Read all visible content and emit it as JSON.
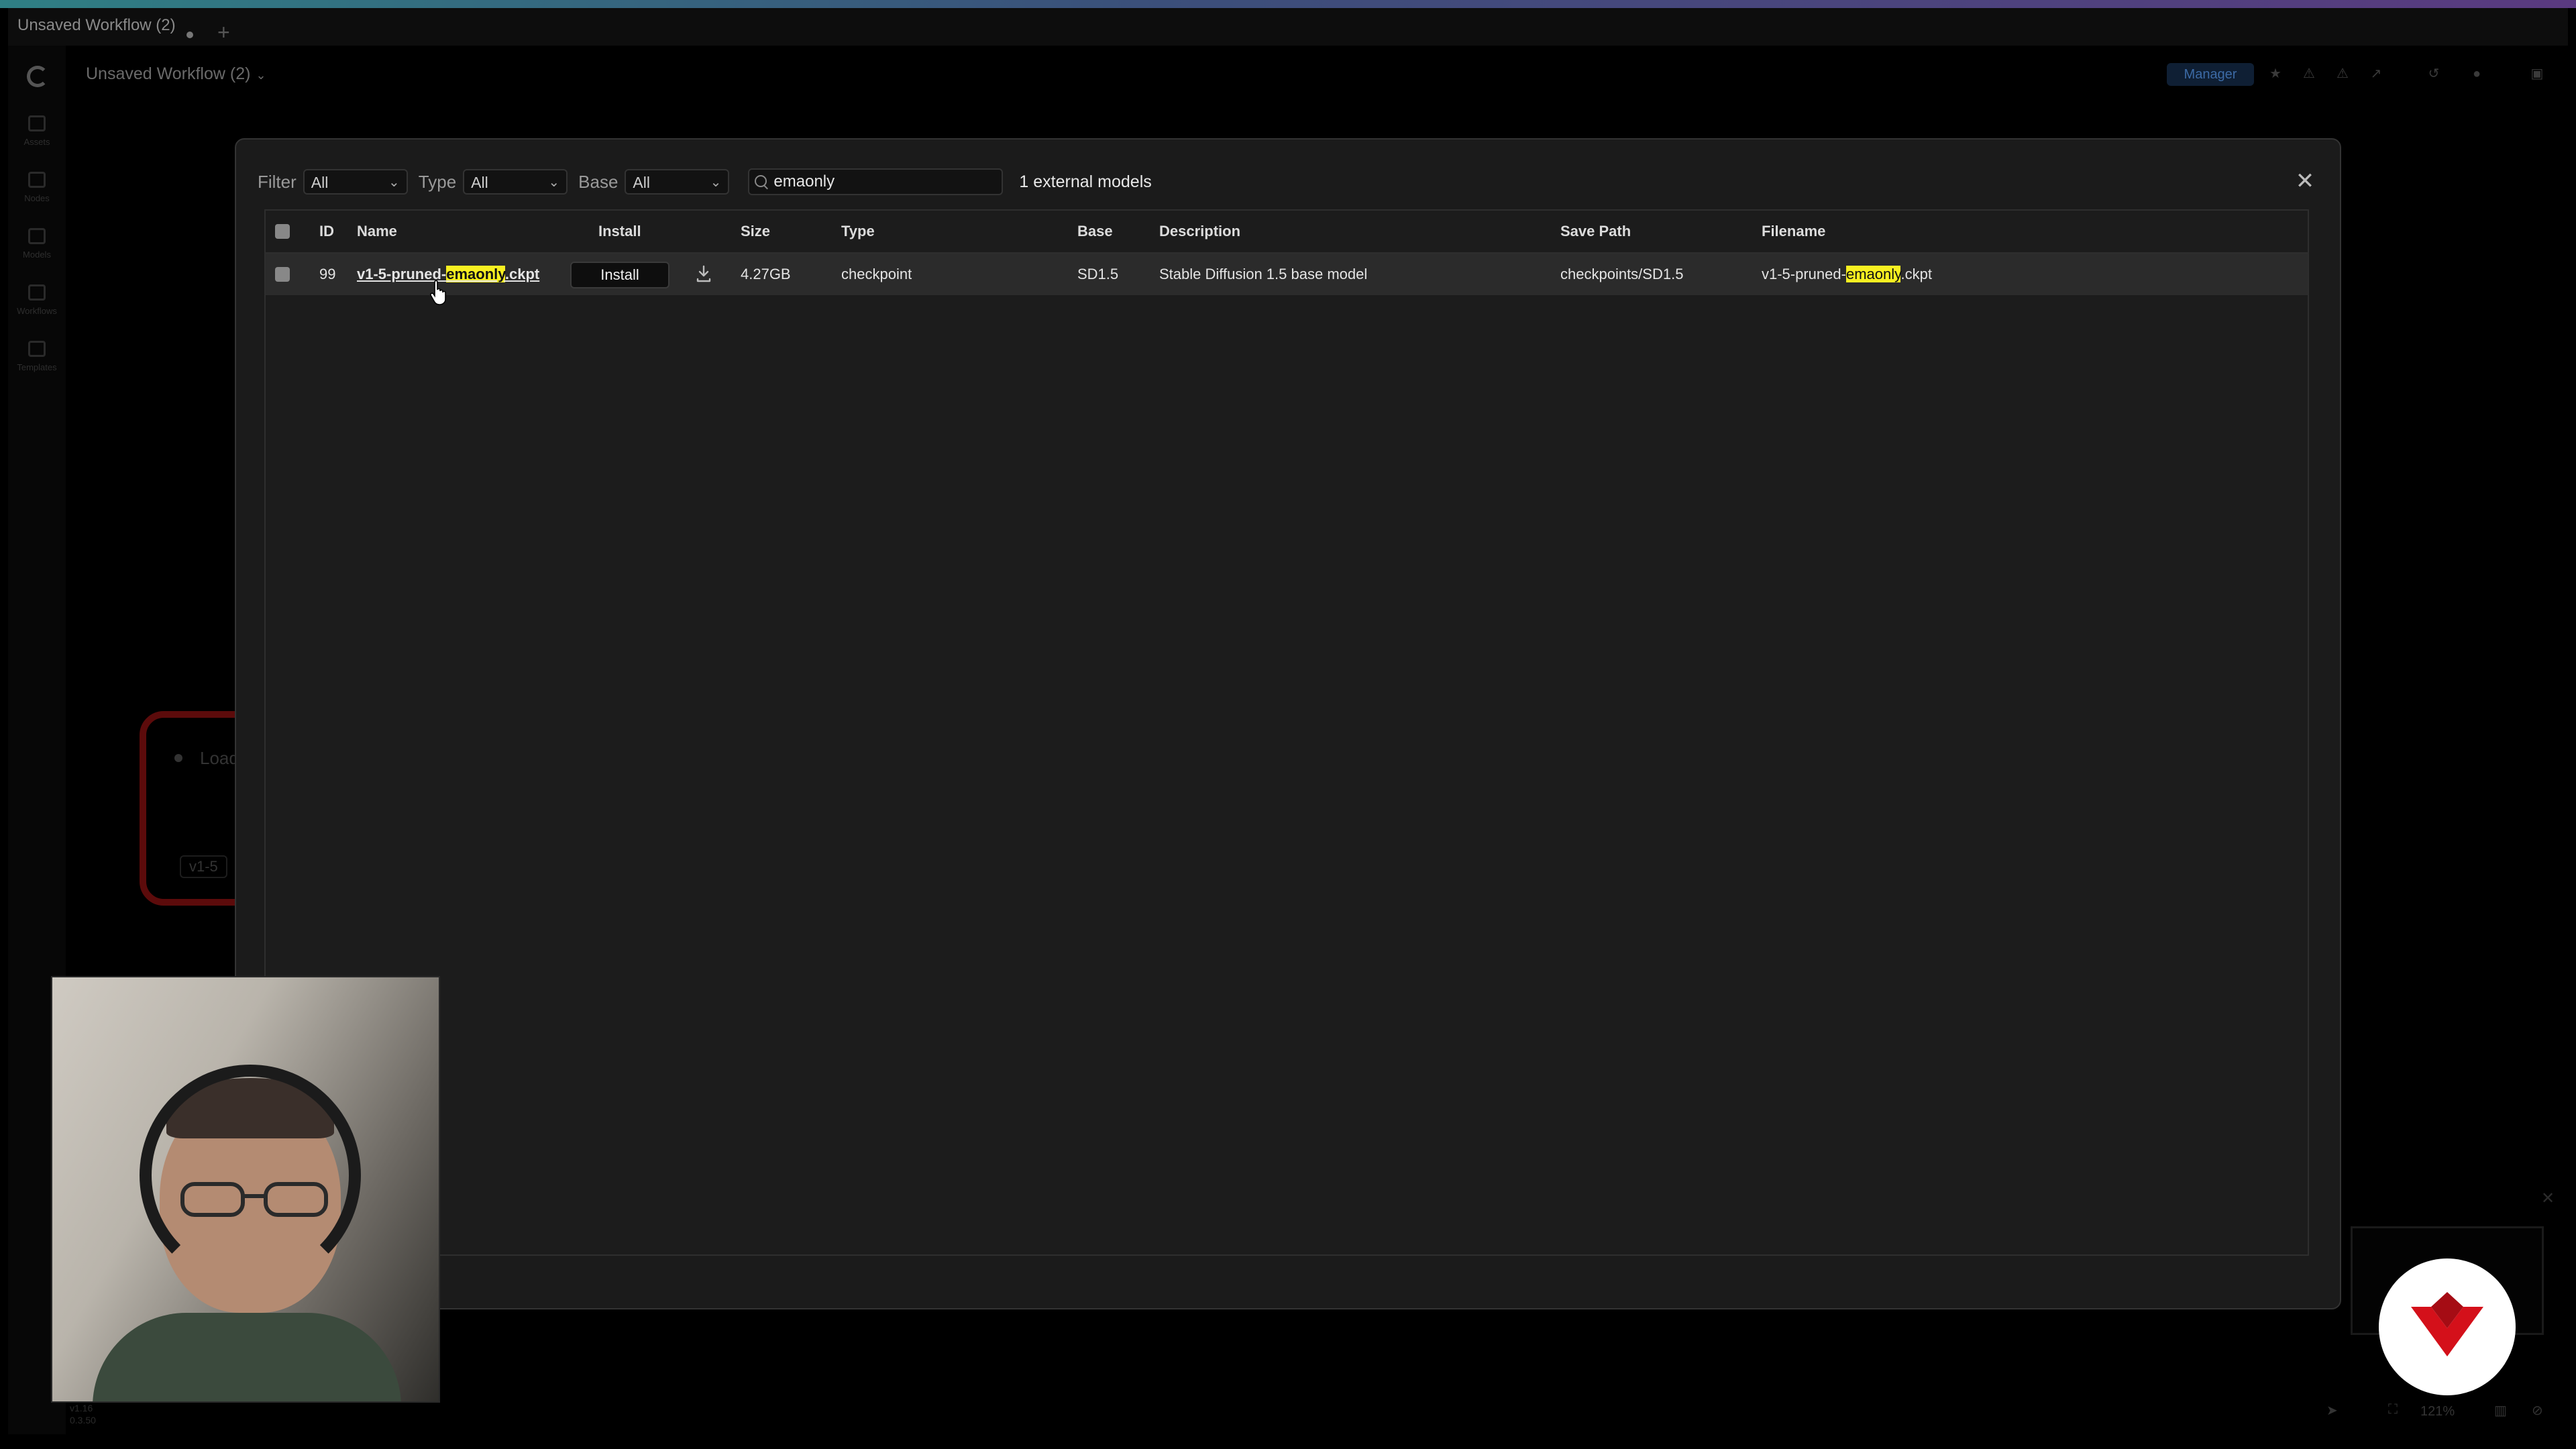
{
  "app": {
    "tab_title": "Unsaved Workflow (2)",
    "workflow_title": "Unsaved Workflow (2)",
    "manager_label": "Manager",
    "sidebar": [
      "Assets",
      "Nodes",
      "Models",
      "Workflows",
      "Templates"
    ],
    "background_node": {
      "title": "Load",
      "value": "v1-5"
    },
    "zoom": "121%",
    "version_line1": "v1.16",
    "version_line2": "0.3.50"
  },
  "dialog": {
    "filters": [
      {
        "label": "Filter",
        "value": "All"
      },
      {
        "label": "Type",
        "value": "All"
      },
      {
        "label": "Base",
        "value": "All"
      }
    ],
    "search": {
      "value": "emaonly",
      "placeholder": ""
    },
    "count_text": "1 external models",
    "close_label": "✕",
    "columns": {
      "id": "ID",
      "name": "Name",
      "install": "Install",
      "size": "Size",
      "type": "Type",
      "base": "Base",
      "description": "Description",
      "save_path": "Save Path",
      "filename": "Filename"
    },
    "rows": [
      {
        "id": "99",
        "name_prefix": "v1-5-pruned-",
        "name_match": "emaonly",
        "name_suffix": ".ckpt",
        "install_label": "Install",
        "size": "4.27GB",
        "type": "checkpoint",
        "base": "SD1.5",
        "description": "Stable Diffusion 1.5 base model",
        "save_path": "checkpoints/SD1.5",
        "filename_prefix": "v1-5-pruned-",
        "filename_match": "emaonly",
        "filename_suffix": ".ckpt"
      }
    ]
  },
  "colors": {
    "highlight": "#f7ef21",
    "link": "#7fc2ff",
    "background": "#000000",
    "dialog": "#1b1b1b",
    "badge_red": "#d4101a"
  },
  "icons": [
    "logo-icon",
    "search-icon",
    "close-icon",
    "download-icon",
    "chevron-down-icon",
    "cursor-icon",
    "channel-logo-icon"
  ]
}
